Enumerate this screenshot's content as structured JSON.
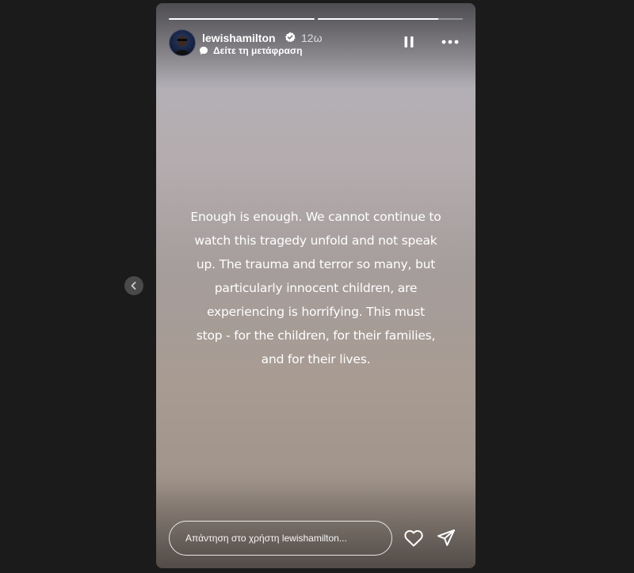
{
  "story": {
    "username": "lewishamilton",
    "timestamp": "12ω",
    "translate_label": "Δείτε τη μετάφραση",
    "progress": [
      1.0,
      0.83
    ],
    "text_lines": [
      "Enough is enough. We cannot continue to",
      "watch this tragedy unfold and not speak",
      "up. The trauma and terror so many, but",
      "particularly innocent children, are",
      "experiencing is horrifying. This must",
      "stop - for the children, for their families,",
      "and for their lives."
    ],
    "reply_placeholder": "Απάντηση στο χρήστη lewishamilton..."
  },
  "icons": {
    "prev": "chevron-left-icon",
    "verified": "verified-badge-icon",
    "translate": "translate-icon",
    "pause": "pause-icon",
    "more": "more-icon",
    "like": "heart-icon",
    "share": "send-icon"
  },
  "colors": {
    "background": "#1b1b1b",
    "text": "#ffffff",
    "verified": "#ffffff"
  }
}
